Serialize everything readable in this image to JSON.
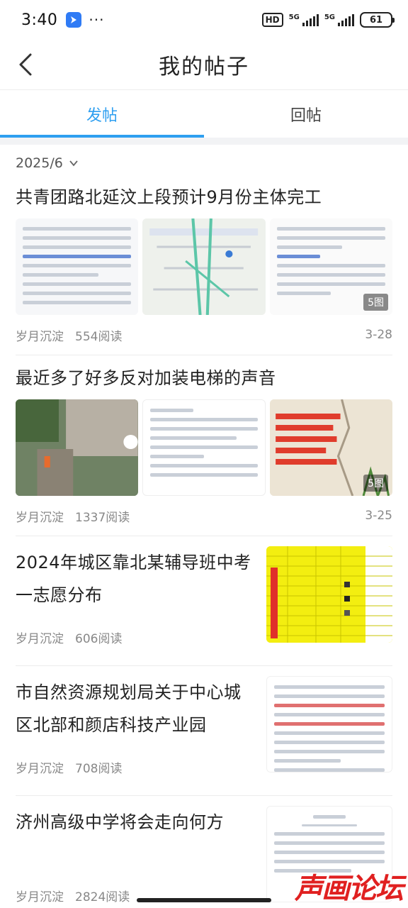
{
  "status_bar": {
    "time": "3:40",
    "dots": "···",
    "hd": "HD",
    "net1": "5G",
    "net2": "5G",
    "battery": "61"
  },
  "nav": {
    "title": "我的帖子"
  },
  "tabs": [
    {
      "label": "发帖",
      "active": true
    },
    {
      "label": "回帖",
      "active": false
    }
  ],
  "filter": {
    "month": "2025/6"
  },
  "posts": [
    {
      "title": "共青团路北延汶上段预计9月份主体完工",
      "author": "岁月沉淀",
      "reads": "554阅读",
      "date": "3-28",
      "image_count": "5图"
    },
    {
      "title": "最近多了好多反对加装电梯的声音",
      "author": "岁月沉淀",
      "reads": "1337阅读",
      "date": "3-25",
      "image_count": "5图"
    },
    {
      "title": "2024年城区靠北某辅导班中考一志愿分布",
      "author": "岁月沉淀",
      "reads": "606阅读"
    },
    {
      "title": "市自然资源规划局关于中心城区北部和颜店科技产业园",
      "author": "岁月沉淀",
      "reads": "708阅读"
    },
    {
      "title": "济州高级中学将会走向何方",
      "author": "岁月沉淀",
      "reads": "2824阅读"
    }
  ],
  "watermark": "声画论坛",
  "colors": {
    "accent": "#2e9ff0",
    "watermark": "#e02020"
  }
}
